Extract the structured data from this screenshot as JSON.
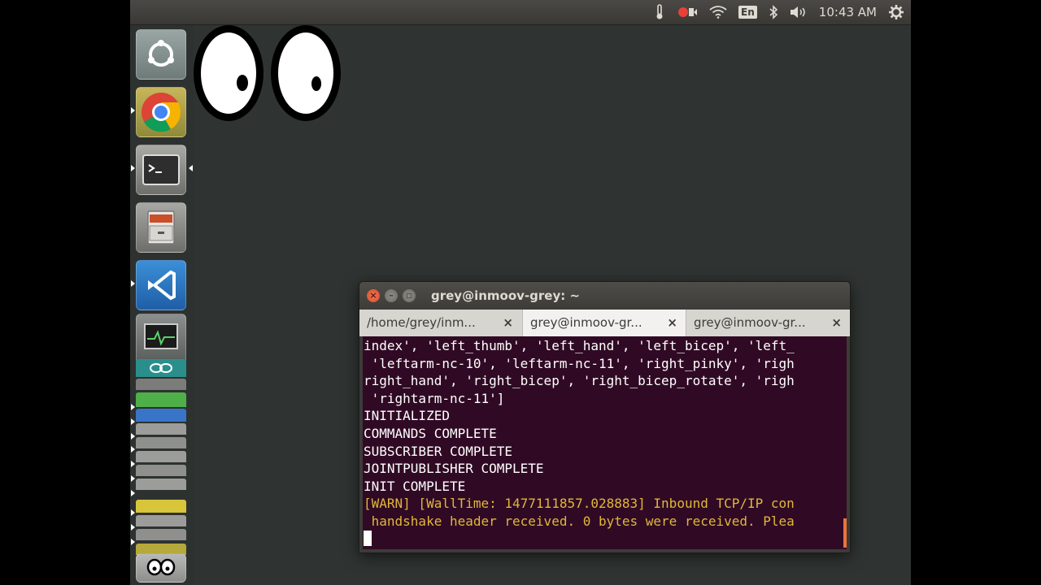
{
  "panel": {
    "language": "En",
    "clock": "10:43 AM"
  },
  "terminal": {
    "title": "grey@inmoov-grey: ~",
    "tabs": [
      {
        "label": "/home/grey/inm...",
        "close": "×"
      },
      {
        "label": "grey@inmoov-gr...",
        "close": "×"
      },
      {
        "label": "grey@inmoov-gr...",
        "close": "×"
      }
    ],
    "lines": [
      {
        "text": "index', 'left_thumb', 'left_hand', 'left_bicep', 'left_",
        "color": "#ffffff"
      },
      {
        "text": " 'leftarm-nc-10', 'leftarm-nc-11', 'right_pinky', 'righ",
        "color": "#ffffff"
      },
      {
        "text": "right_hand', 'right_bicep', 'right_bicep_rotate', 'righ",
        "color": "#ffffff"
      },
      {
        "text": " 'rightarm-nc-11']",
        "color": "#ffffff"
      },
      {
        "text": "INITIALIZED",
        "color": "#ffffff"
      },
      {
        "text": "COMMANDS COMPLETE",
        "color": "#ffffff"
      },
      {
        "text": "SUBSCRIBER COMPLETE",
        "color": "#ffffff"
      },
      {
        "text": "JOINTPUBLISHER COMPLETE",
        "color": "#ffffff"
      },
      {
        "text": "INIT COMPLETE",
        "color": "#ffffff"
      },
      {
        "text": "[WARN] [WallTime: 1477111857.028883] Inbound TCP/IP con",
        "color": "#e0b73a"
      },
      {
        "text": " handshake header received. 0 bytes were received. Plea",
        "color": "#e0b73a"
      }
    ]
  },
  "colors": {
    "terminal_bg": "#300a24",
    "warn": "#e0b73a",
    "desktop": "#2f3432"
  }
}
